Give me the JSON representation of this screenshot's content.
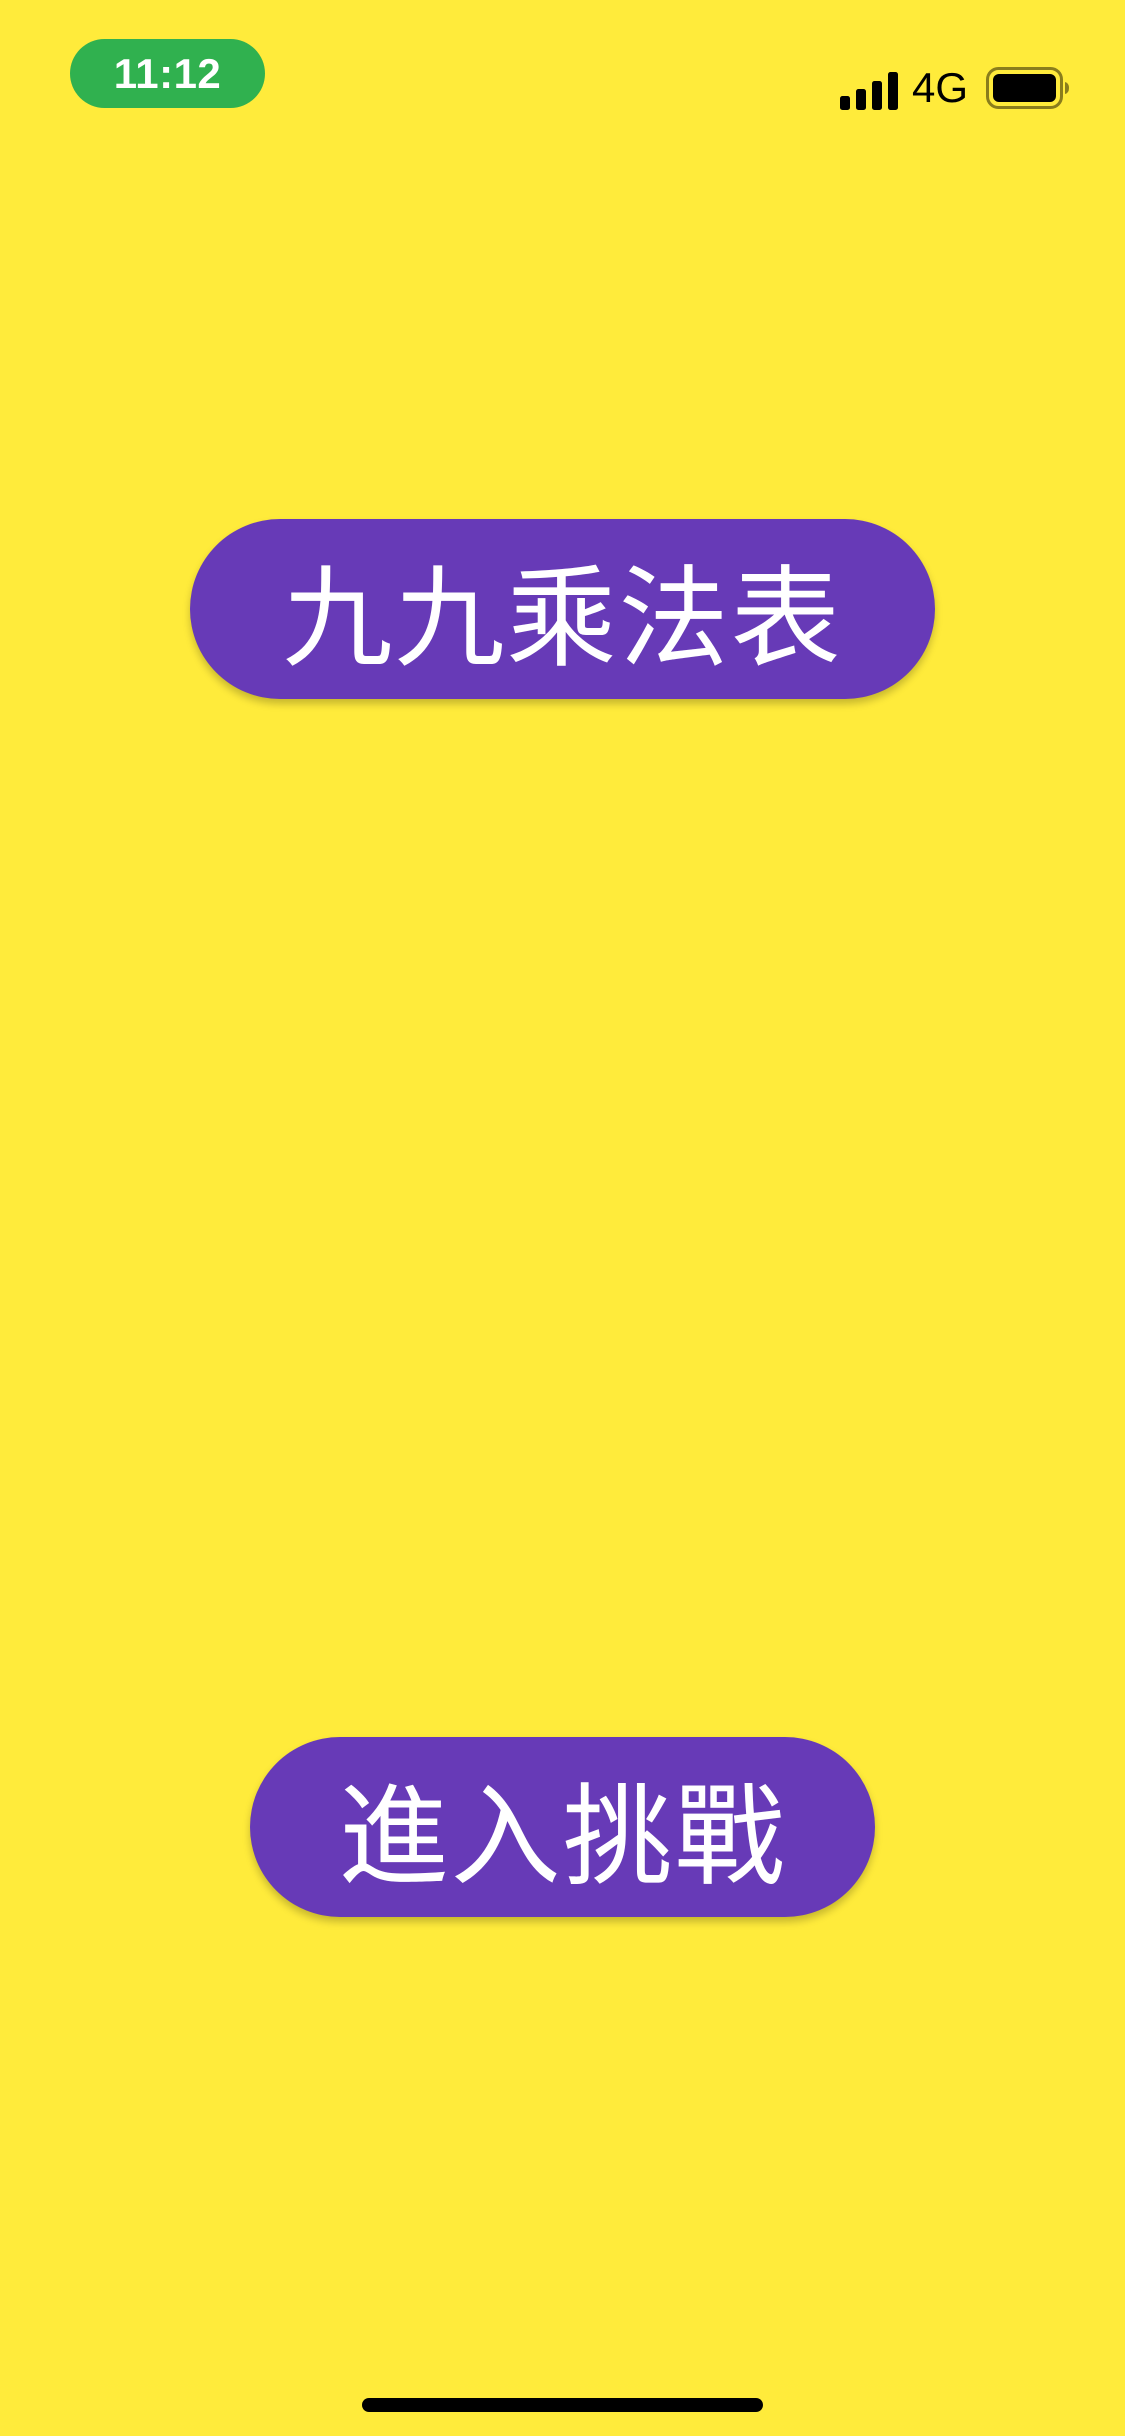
{
  "colors": {
    "background": "#FFEB3B",
    "button": "#673AB7",
    "time_pill": "#30B14F"
  },
  "status_bar": {
    "time": "11:12",
    "network": "4G",
    "icons": [
      "signal-bars-icon",
      "battery-icon"
    ]
  },
  "main": {
    "multiplication_table_label": "九九乘法表",
    "challenge_label": "進入挑戰"
  }
}
